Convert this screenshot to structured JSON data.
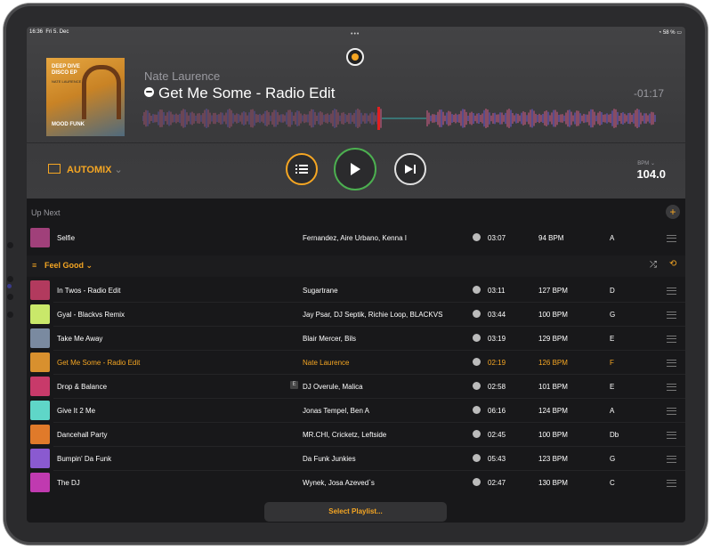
{
  "status": {
    "time": "16:36",
    "date": "Fri 5. Dec",
    "battery": "58 %"
  },
  "now_playing": {
    "artist": "Nate Laurence",
    "title": "Get Me Some - Radio Edit",
    "remaining": "-01:17",
    "cover": {
      "line1": "DEEP DIVE DISCO EP",
      "line2": "NATE LAURENCE",
      "line3": "MOOD FUNK"
    }
  },
  "controls": {
    "automix_label": "AUTOMIX",
    "bpm_label": "BPM",
    "bpm_value": "104.0"
  },
  "up_next": {
    "label": "Up Next",
    "add_icon": "+",
    "track": {
      "title": "Selfie",
      "artist": "Fernandez, Aire Urbano, Kenna I",
      "duration": "03:07",
      "bpm": "94 BPM",
      "key": "A"
    }
  },
  "playlist": {
    "name": "Feel Good",
    "tracks": [
      {
        "title": "In Twos - Radio Edit",
        "artist": "Sugartrane",
        "duration": "03:11",
        "bpm": "127 BPM",
        "key": "D",
        "art": "#b23a5e"
      },
      {
        "title": "Gyal - Blackvs Remix",
        "artist": "Jay Psar, DJ Septik, Richie Loop, BLACKVS",
        "duration": "03:44",
        "bpm": "100 BPM",
        "key": "G",
        "art": "#c9e86a"
      },
      {
        "title": "Take Me Away",
        "artist": "Blair Mercer, Bils",
        "duration": "03:19",
        "bpm": "129 BPM",
        "key": "E",
        "art": "#7a8aa0"
      },
      {
        "title": "Get Me Some - Radio Edit",
        "artist": "Nate Laurence",
        "duration": "02:19",
        "bpm": "126 BPM",
        "key": "F",
        "art": "#d8902e",
        "selected": true
      },
      {
        "title": "Drop & Balance",
        "artist": "DJ Overule, Malica",
        "duration": "02:58",
        "bpm": "101 BPM",
        "key": "E",
        "art": "#c83a6a",
        "explicit": "E"
      },
      {
        "title": "Give It 2 Me",
        "artist": "Jonas Tempel, Ben A",
        "duration": "06:16",
        "bpm": "124 BPM",
        "key": "A",
        "art": "#5fd6c8"
      },
      {
        "title": "Dancehall Party",
        "artist": "MR.CHI, Cricketz, Leftside",
        "duration": "02:45",
        "bpm": "100 BPM",
        "key": "Db",
        "art": "#e07a2a"
      },
      {
        "title": "Bumpin' Da Funk",
        "artist": "Da Funk Junkies",
        "duration": "05:43",
        "bpm": "123 BPM",
        "key": "G",
        "art": "#8a5ad0"
      },
      {
        "title": "The DJ",
        "artist": "Wynek, Josa Azeved`s",
        "duration": "02:47",
        "bpm": "130 BPM",
        "key": "C",
        "art": "#c03ab0"
      }
    ]
  },
  "select_playlist": "Select Playlist...",
  "colors": {
    "accent": "#f5a623",
    "play_ring": "#4caf50"
  }
}
